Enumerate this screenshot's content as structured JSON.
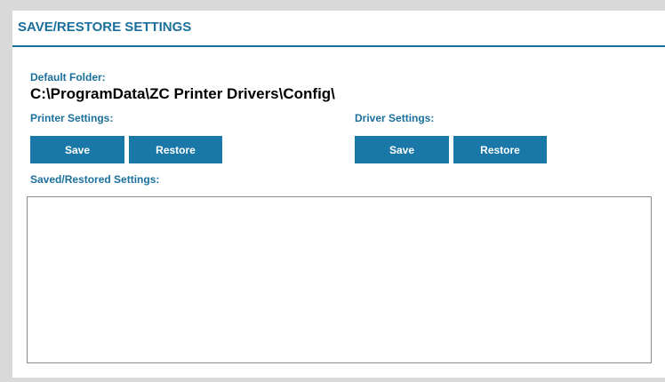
{
  "panel": {
    "title": "SAVE/RESTORE SETTINGS"
  },
  "default_folder": {
    "label": "Default Folder:",
    "path": "C:\\ProgramData\\ZC Printer Drivers\\Config\\"
  },
  "printer_settings": {
    "label": "Printer Settings:",
    "save_label": "Save",
    "restore_label": "Restore"
  },
  "driver_settings": {
    "label": "Driver Settings:",
    "save_label": "Save",
    "restore_label": "Restore"
  },
  "saved_restored": {
    "label": "Saved/Restored Settings:",
    "content": ""
  },
  "colors": {
    "accent": "#1a6f9c",
    "button": "#1a78a8",
    "frame": "#d9d9d9"
  }
}
